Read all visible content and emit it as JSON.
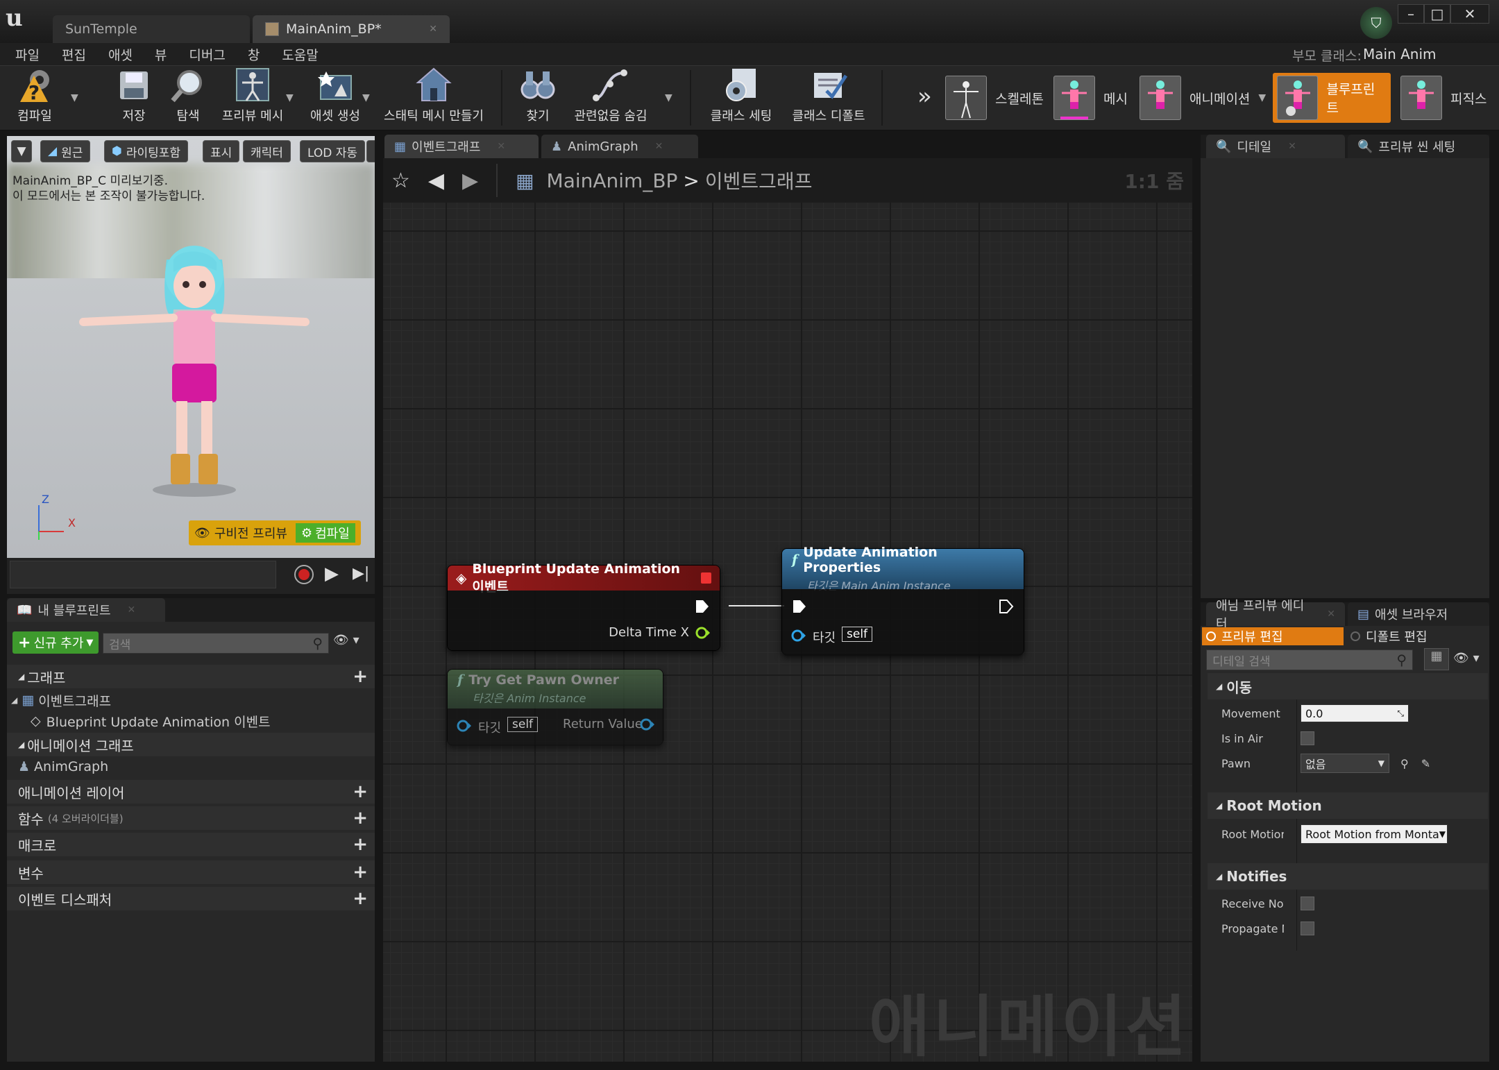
{
  "window": {
    "tabs": [
      "SunTemple",
      "MainAnim_BP*"
    ],
    "controls": [
      "–",
      "□",
      "✕"
    ]
  },
  "menu": {
    "items": [
      "파일",
      "편집",
      "애셋",
      "뷰",
      "디버그",
      "창",
      "도움말"
    ],
    "parent_class_label": "부모 클래스:",
    "parent_class_value": "Main Anim Instance"
  },
  "toolbar": {
    "compile": "컴파일",
    "save": "저장",
    "browse": "탐색",
    "preview_mesh": "프리뷰 메시",
    "asset_create": "애셋 생성",
    "make_static_mesh": "스태틱 메시 만들기",
    "find": "찾기",
    "hide_unrelated": "관련없음 숨김",
    "class_settings": "클래스 세팅",
    "class_defaults": "클래스 디폴트",
    "more": "»"
  },
  "modes": [
    "스켈레톤",
    "메시",
    "애니메이션",
    "블루프린트",
    "피직스"
  ],
  "viewport": {
    "buttons": [
      "원근",
      "라이팅포함",
      "표시",
      "캐릭터",
      "LOD 자동"
    ],
    "info_line1": "MainAnim_BP_C 미리보기중.",
    "info_line2": "이 모드에서는 본 조작이 불가능합니다.",
    "axis_z": "Z",
    "axis_x": "X",
    "outdated_preview": "구비전 프리뷰",
    "compile_btn": "컴파일"
  },
  "graph_tabs": [
    "이벤트그래프",
    "AnimGraph"
  ],
  "graph": {
    "breadcrumb_root": "MainAnim_BP",
    "breadcrumb_sep": ">",
    "breadcrumb_current": "이벤트그래프",
    "zoom": "1:1 줌",
    "watermark": "애니메이션",
    "nodes": {
      "event": {
        "title": "Blueprint Update Animation 이벤트",
        "pin": "Delta Time X"
      },
      "update": {
        "title": "Update Animation Properties",
        "subtitle": "타깃은 Main Anim Instance",
        "target_label": "타깃",
        "self": "self"
      },
      "pawn": {
        "title": "Try Get Pawn Owner",
        "subtitle": "타깃은 Anim Instance",
        "target_label": "타깃",
        "self": "self",
        "return": "Return Value"
      }
    }
  },
  "my_blueprint": {
    "tab": "내 블루프린트",
    "add_new": "신규 추가",
    "search_placeholder": "검색",
    "graphs_header": "그래프",
    "event_graph": "이벤트그래프",
    "event_item": "Blueprint Update Animation 이벤트",
    "anim_graphs_header": "애니메이션 그래프",
    "anim_graph_item": "AnimGraph",
    "anim_layers": "애니메이션 레이어",
    "functions": "함수",
    "functions_note": "(4 오버라이더블)",
    "macros": "매크로",
    "variables": "변수",
    "dispatchers": "이벤트 디스패처"
  },
  "right_tabs": [
    "디테일",
    "프리뷰 씬 세팅"
  ],
  "bottom_right_tabs": [
    "애님 프리뷰 에디터",
    "애셋 브라우저"
  ],
  "details": {
    "preview_edit": "프리뷰 편집",
    "default_edit": "디폴트 편집",
    "search_placeholder": "디테일 검색",
    "cat_movement": "이동",
    "movement_speed_label": "Movement Spee",
    "movement_speed_value": "0.0",
    "is_in_air_label": "Is in Air",
    "pawn_label": "Pawn",
    "pawn_value": "없음",
    "cat_root_motion": "Root Motion",
    "root_motion_label": "Root Motion Mc",
    "root_motion_value": "Root Motion from Monta",
    "cat_notifies": "Notifies",
    "receive_notifies": "Receive Notifies",
    "propagate_notifies": "Propagate Notif"
  },
  "colors": {
    "accent_orange": "#e07b12",
    "event_node_red": "#8b1a1a",
    "function_node_blue": "#2c5b82",
    "exec_pin": "#ffffff",
    "float_pin": "#9be02b",
    "object_pin": "#2fa4e7"
  }
}
